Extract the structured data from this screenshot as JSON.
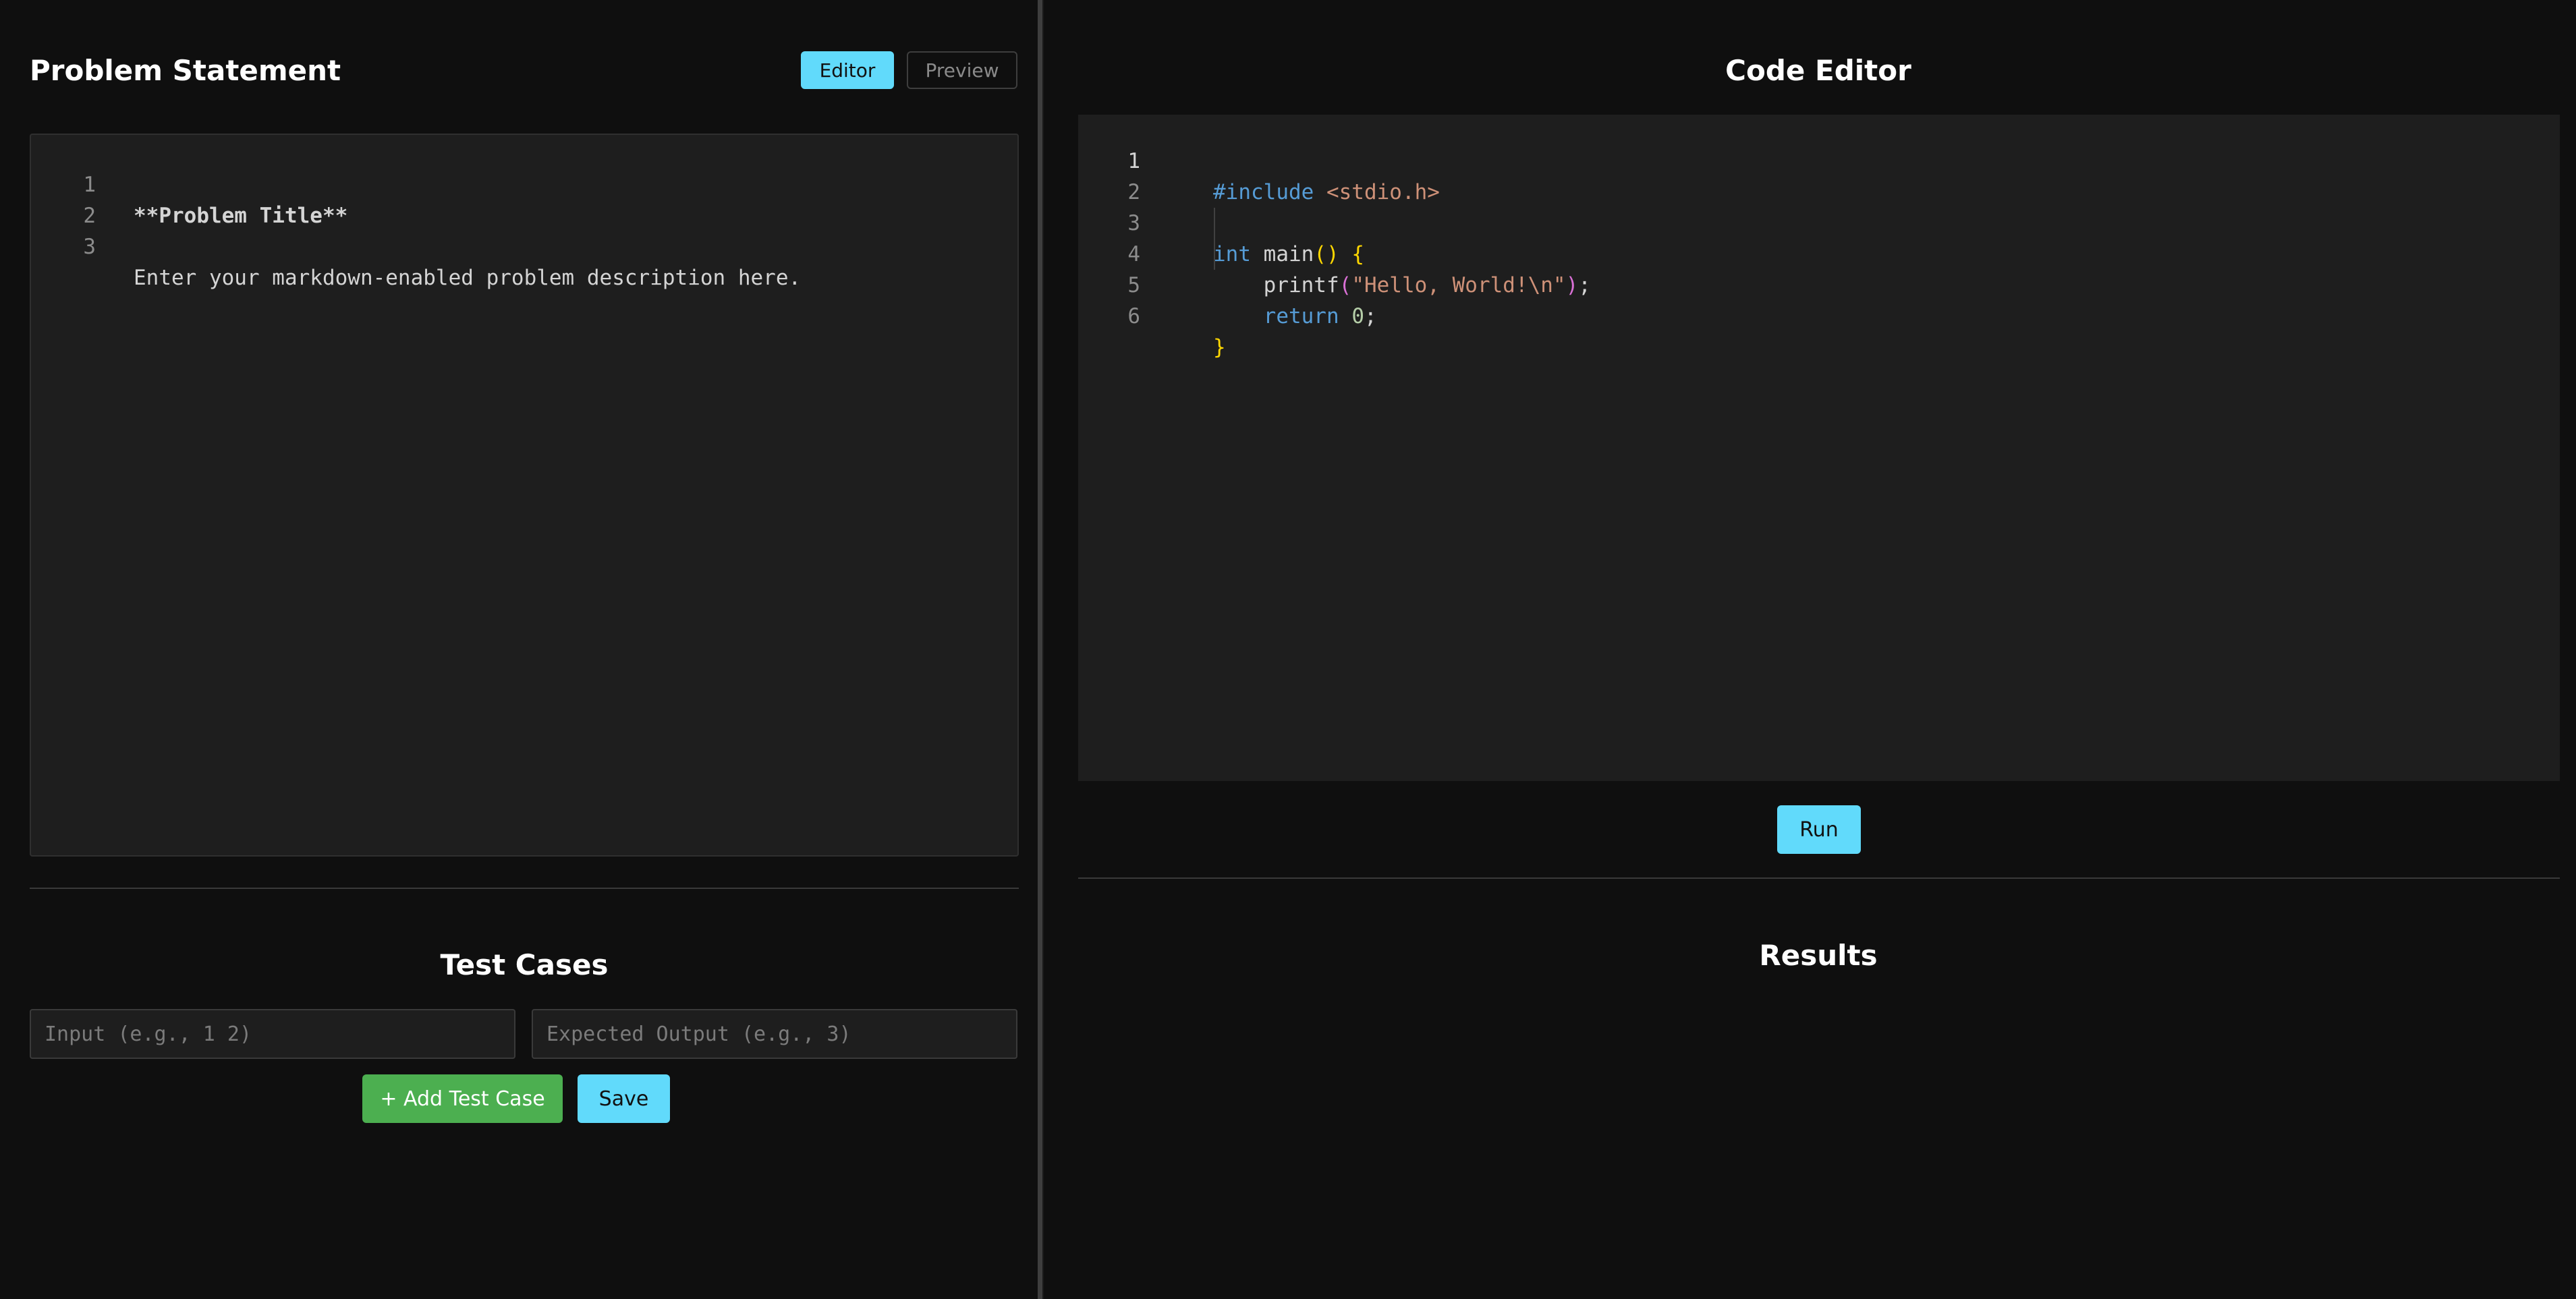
{
  "left": {
    "title": "Problem Statement",
    "mode_buttons": {
      "editor": "Editor",
      "preview": "Preview"
    },
    "markdown_editor": {
      "lines": [
        {
          "n": "1",
          "text": "**Problem Title**"
        },
        {
          "n": "2",
          "text": ""
        },
        {
          "n": "3",
          "text": "Enter your markdown-enabled problem description here."
        }
      ]
    },
    "test_cases": {
      "title": "Test Cases",
      "input_placeholder": "Input (e.g., 1 2)",
      "output_placeholder": "Expected Output (e.g., 3)",
      "add_label": "+ Add Test Case",
      "save_label": "Save"
    }
  },
  "right": {
    "title": "Code Editor",
    "code": {
      "line_numbers": [
        "1",
        "2",
        "3",
        "4",
        "5",
        "6"
      ],
      "l1_directive": "#include",
      "l1_header": "<stdio.h>",
      "l3_type": "int",
      "l3_name": "main",
      "l3_parens": "()",
      "l3_brace": "{",
      "l4_fn": "printf",
      "l4_open": "(",
      "l4_string": "\"Hello, World!\\n\"",
      "l4_close": ")",
      "l4_semi": ";",
      "l5_kw": "return",
      "l5_num": "0",
      "l5_semi": ";",
      "l6_brace": "}"
    },
    "run_label": "Run",
    "results_title": "Results"
  },
  "colors": {
    "accent": "#61dafb",
    "add_button": "#4caf50",
    "background": "#0f0f0f",
    "editor_bg": "#1e1e1e"
  }
}
